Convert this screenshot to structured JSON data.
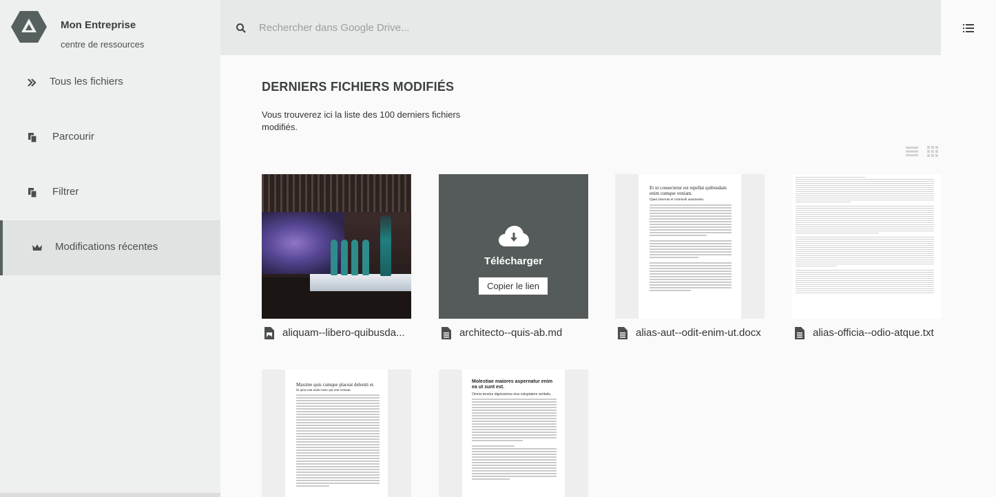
{
  "brand": {
    "name": "Mon Entreprise",
    "subtitle": "centre de ressources"
  },
  "sidebar": {
    "items": [
      {
        "label": "Tous les fichiers",
        "icon": "double-chevron-right-icon",
        "active": false
      },
      {
        "label": "Parcourir",
        "icon": "copy-files-icon",
        "active": false
      },
      {
        "label": "Filtrer",
        "icon": "copy-files-icon",
        "active": false
      },
      {
        "label": "Modifications récentes",
        "icon": "crown-icon",
        "active": true
      }
    ]
  },
  "search": {
    "placeholder": "Rechercher dans Google Drive..."
  },
  "main": {
    "title": "DERNIERS FICHIERS MODIFIÉS",
    "description": "Vous trouverez ici la liste des 100 derniers fichiers modifiés."
  },
  "download_overlay": {
    "label": "Télécharger",
    "copy_label": "Copier le lien"
  },
  "files": [
    {
      "name": "aliquam--libero-quibusda...",
      "type": "image"
    },
    {
      "name": "architecto--quis-ab.md",
      "type": "document"
    },
    {
      "name": "alias-aut--odit-enim-ut.docx",
      "type": "document"
    },
    {
      "name": "alias-officia--odio-atque.txt",
      "type": "document"
    },
    {
      "name": "",
      "type": "document"
    },
    {
      "name": "",
      "type": "document"
    }
  ],
  "doc_previews": {
    "docx_title": "Et ut consectetur est repellat quibusdam enim cumque veniam.",
    "docx_subtitle": "Quasi laborum et commodi assumenda.",
    "doc5_title": "Maxime quis cumque placeat deleniti et.",
    "doc5_subtitle": "In quia sunt enim iusto qui rem veniam.",
    "doc6_title": "Molestiae maiores aspernatur enim ea ut sunt est.",
    "doc6_subtitle": "Omnis tenetur dignissimos eius voluptatem veritatis."
  },
  "colors": {
    "sidebar_bg": "#eef0ef",
    "active_bg": "#dfe3e2",
    "topbar_bg": "#e6e9e8",
    "download_bg": "#545b5a",
    "logo": "#56605f"
  }
}
